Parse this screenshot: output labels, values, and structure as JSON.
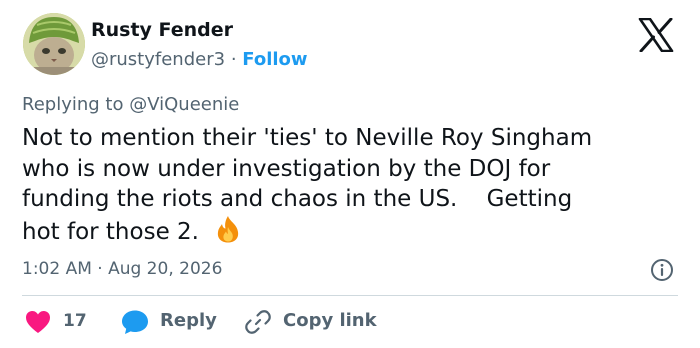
{
  "author": {
    "name": "Rusty Fender",
    "handle": "@rustyfender3",
    "separator": "·",
    "follow_label": "Follow"
  },
  "replying": {
    "prefix": "Replying to",
    "handle": "@ViQueenie"
  },
  "tweet": {
    "lines": [
      "Not to mention their 'ties' to Neville Roy Singham",
      "who is now under investigation by the DOJ for",
      "funding the riots and chaos in the US.    Getting",
      "hot for those 2."
    ],
    "emoji": "fire-icon",
    "timestamp": "1:02 AM · Aug 20, 2026"
  },
  "actions": {
    "like_count": "17",
    "reply_label": "Reply",
    "copy_label": "Copy link"
  },
  "colors": {
    "text": "#0f1419",
    "muted": "#536471",
    "accent": "#1d9bf0",
    "like": "#f91880",
    "divider": "#cfd9de"
  },
  "icons": {
    "logo": "x-logo-icon",
    "info": "info-icon",
    "like": "heart-icon",
    "reply": "reply-bubble-icon",
    "copy": "link-icon"
  }
}
